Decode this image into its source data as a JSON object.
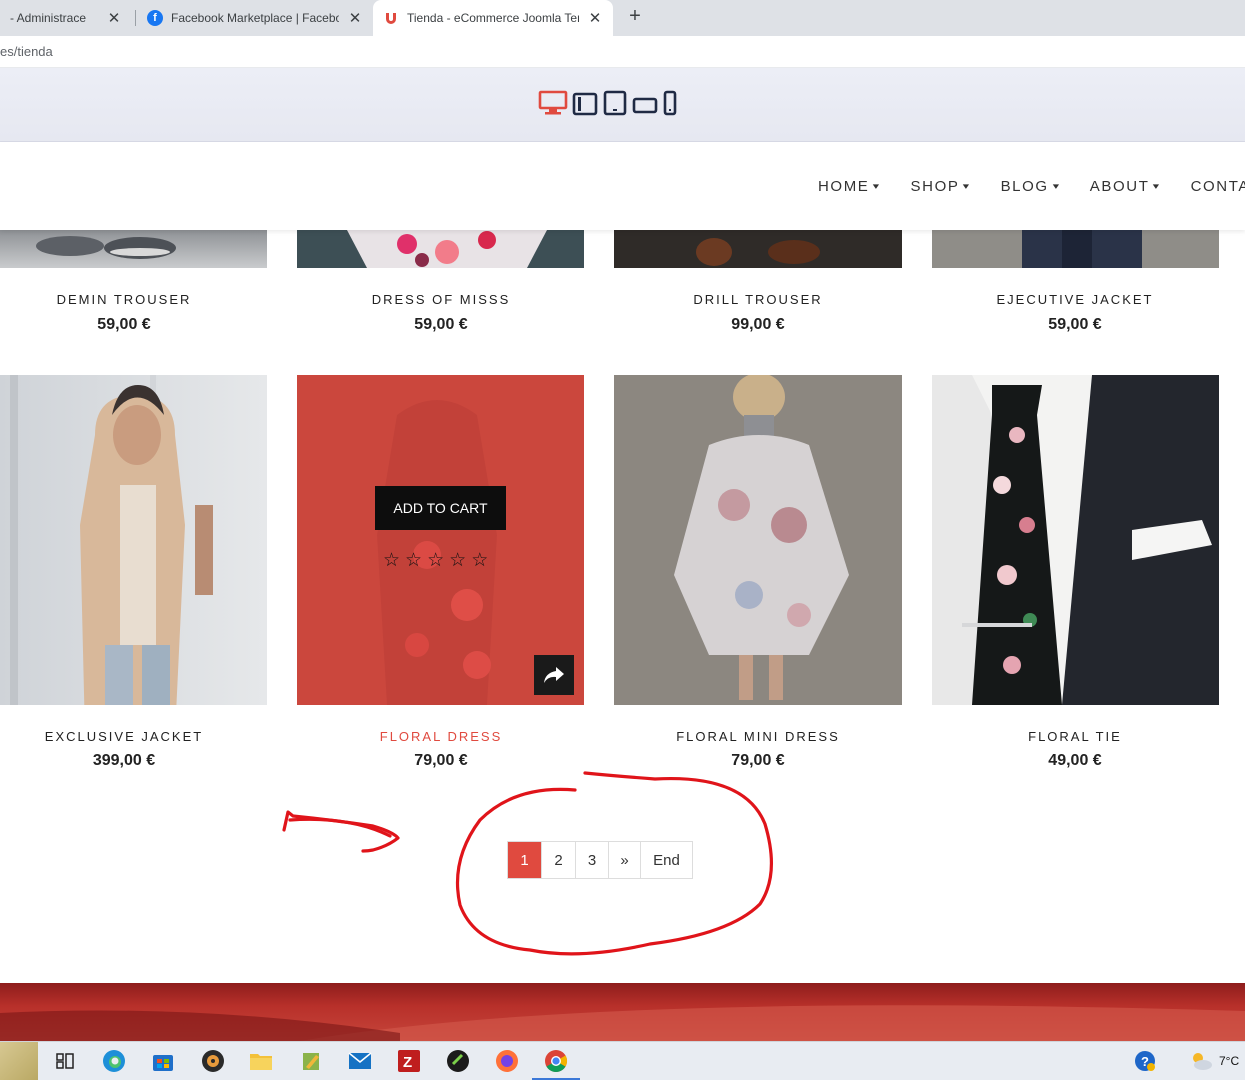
{
  "browser": {
    "tabs": [
      {
        "title": "- Administrace",
        "close": "✕"
      },
      {
        "title": "Facebook Marketplace | Faceboo",
        "close": "✕"
      },
      {
        "title": "Tienda - eCommerce Joomla Tem",
        "close": "✕"
      }
    ],
    "new_tab": "+",
    "url": "es/tienda"
  },
  "nav": {
    "items": [
      {
        "label": "HOME",
        "chev": "▾"
      },
      {
        "label": "SHOP",
        "chev": "▾"
      },
      {
        "label": "BLOG",
        "chev": "▾"
      },
      {
        "label": "ABOUT",
        "chev": "▾"
      },
      {
        "label": "CONTA"
      }
    ]
  },
  "products_row1": [
    {
      "name": "DEMIN TROUSER",
      "price": "59,00 €"
    },
    {
      "name": "DRESS OF MISSS",
      "price": "59,00 €"
    },
    {
      "name": "DRILL TROUSER",
      "price": "99,00 €"
    },
    {
      "name": "EJECUTIVE JACKET",
      "price": "59,00 €"
    }
  ],
  "products_row2": [
    {
      "name": "EXCLUSIVE JACKET",
      "price": "399,00 €"
    },
    {
      "name": "FLORAL DRESS",
      "price": "79,00 €"
    },
    {
      "name": "FLORAL MINI DRESS",
      "price": "79,00 €"
    },
    {
      "name": "FLORAL TIE",
      "price": "49,00 €"
    }
  ],
  "hover_card": {
    "add_to_cart": "ADD TO CART",
    "rating": 0,
    "rating_max": 5,
    "star_glyph": "☆"
  },
  "pagination": {
    "pages": [
      "1",
      "2",
      "3"
    ],
    "next": "»",
    "end": "End",
    "active": "1"
  },
  "taskbar": {
    "temperature": "7°C"
  },
  "colors": {
    "accent": "#e04a3f",
    "annotation": "#e0141a"
  }
}
